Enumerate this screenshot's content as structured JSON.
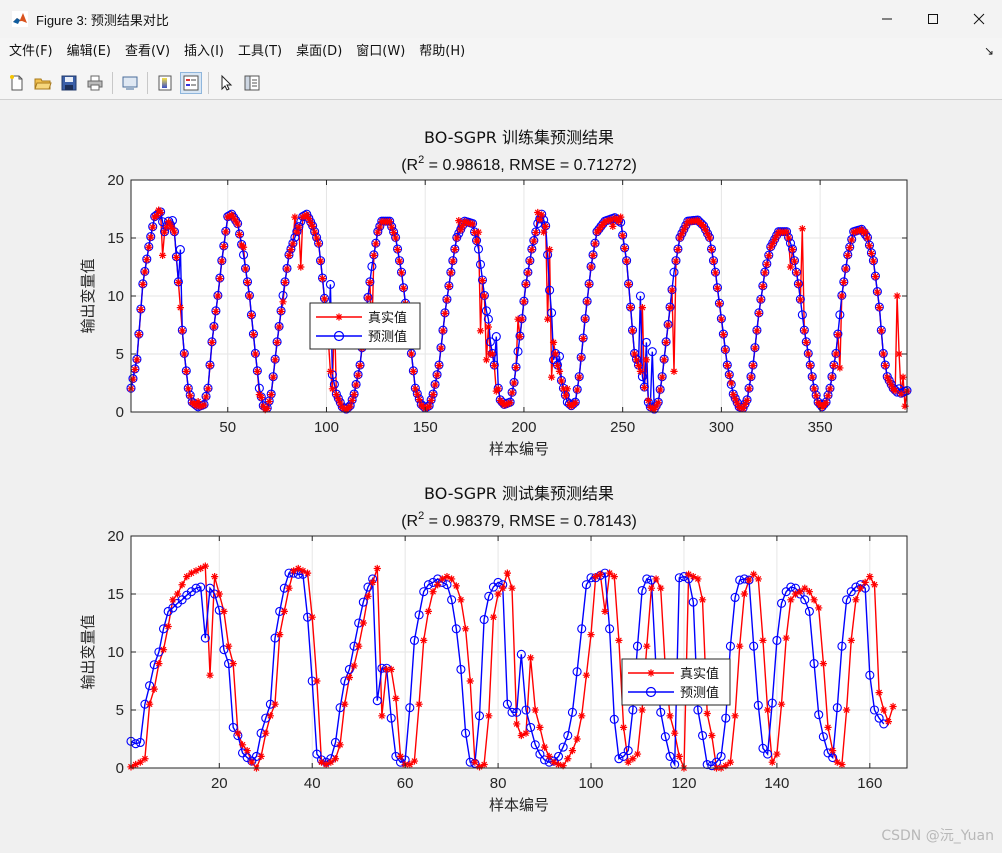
{
  "window": {
    "title": "Figure 3: 预测结果对比",
    "controls": {
      "minimize": "—",
      "maximize": "☐",
      "close": "✕"
    }
  },
  "menu": {
    "items": [
      "文件(F)",
      "编辑(E)",
      "查看(V)",
      "插入(I)",
      "工具(T)",
      "桌面(D)",
      "窗口(W)",
      "帮助(H)"
    ],
    "overflow_arrow": "↘"
  },
  "toolbar": {
    "buttons": [
      "new-file-icon",
      "open-folder-icon",
      "save-icon",
      "print-icon",
      "link-figure-icon",
      "colorbar-icon",
      "legend-icon",
      "pointer-icon",
      "property-inspector-icon"
    ]
  },
  "colors": {
    "true": "#ff0000",
    "pred": "#0000ff",
    "axes_bg": "#ffffff",
    "grid": "#e6e6e6"
  },
  "watermark": "CSDN @沅_Yuan",
  "chart_data": [
    {
      "type": "line",
      "title": "BO-SGPR 训练集预测结果",
      "subtitle_prefix": "(R",
      "subtitle_sup": "2",
      "subtitle_suffix": " = 0.98618, RMSE = 0.71272)",
      "xlabel": "样本编号",
      "ylabel": "输出变量值",
      "xlim": [
        1,
        394
      ],
      "ylim": [
        0,
        20
      ],
      "xticks": [
        50,
        100,
        150,
        200,
        250,
        300,
        350
      ],
      "yticks": [
        0,
        5,
        10,
        15,
        20
      ],
      "grid": true,
      "legend": {
        "position": "center",
        "entries": [
          "真实值",
          "预测值"
        ]
      },
      "n": 394,
      "anchors": [
        [
          1,
          2
        ],
        [
          4,
          4.5
        ],
        [
          7,
          11
        ],
        [
          10,
          14.2
        ],
        [
          13,
          16.8
        ],
        [
          16,
          17.2
        ],
        [
          18,
          15.5
        ],
        [
          20,
          16.4
        ],
        [
          23,
          15.5
        ],
        [
          26,
          9
        ],
        [
          28,
          5
        ],
        [
          30,
          2
        ],
        [
          32,
          0.8
        ],
        [
          35,
          0.4
        ],
        [
          38,
          0.6
        ],
        [
          40,
          2
        ],
        [
          42,
          6
        ],
        [
          45,
          10
        ],
        [
          47,
          13
        ],
        [
          50,
          16.8
        ],
        [
          52,
          17
        ],
        [
          55,
          16.2
        ],
        [
          58,
          13.5
        ],
        [
          61,
          10
        ],
        [
          64,
          5
        ],
        [
          66,
          2
        ],
        [
          68,
          0.5
        ],
        [
          70,
          0.3
        ],
        [
          72,
          1.5
        ],
        [
          75,
          6
        ],
        [
          78,
          10
        ],
        [
          81,
          13.5
        ],
        [
          85,
          15.5
        ],
        [
          88,
          16.8
        ],
        [
          90,
          17
        ],
        [
          93,
          16
        ],
        [
          96,
          14.5
        ],
        [
          98,
          11.5
        ],
        [
          100,
          8
        ],
        [
          102,
          4
        ],
        [
          105,
          1.5
        ],
        [
          108,
          0.4
        ],
        [
          110,
          0.2
        ],
        [
          112,
          0.5
        ],
        [
          114,
          1.5
        ],
        [
          117,
          4
        ],
        [
          120,
          8.5
        ],
        [
          123,
          12.5
        ],
        [
          126,
          15.5
        ],
        [
          128,
          16.4
        ],
        [
          132,
          16.4
        ],
        [
          135,
          15
        ],
        [
          138,
          12
        ],
        [
          141,
          8
        ],
        [
          143,
          5
        ],
        [
          145,
          2
        ],
        [
          148,
          0.6
        ],
        [
          150,
          0.3
        ],
        [
          152,
          0.5
        ],
        [
          154,
          1.5
        ],
        [
          157,
          4
        ],
        [
          160,
          8.5
        ],
        [
          163,
          12
        ],
        [
          166,
          15
        ],
        [
          170,
          16.4
        ],
        [
          174,
          16.2
        ],
        [
          177,
          14
        ],
        [
          180,
          10
        ],
        [
          183,
          6
        ],
        [
          186,
          3
        ],
        [
          188,
          1
        ],
        [
          190,
          0.6
        ],
        [
          193,
          0.8
        ],
        [
          195,
          2.5
        ],
        [
          198,
          6.5
        ],
        [
          201,
          11
        ],
        [
          204,
          14
        ],
        [
          207,
          16.2
        ],
        [
          209,
          17
        ],
        [
          211,
          16
        ],
        [
          213,
          11
        ],
        [
          215,
          6
        ],
        [
          217,
          4
        ],
        [
          220,
          2
        ],
        [
          222,
          0.8
        ],
        [
          224,
          0.5
        ],
        [
          226,
          0.8
        ],
        [
          228,
          3
        ],
        [
          231,
          8
        ],
        [
          234,
          12.5
        ],
        [
          237,
          15.5
        ],
        [
          241,
          16.4
        ],
        [
          246,
          16.7
        ],
        [
          249,
          16.3
        ],
        [
          252,
          13
        ],
        [
          254,
          9
        ],
        [
          256,
          5
        ],
        [
          258,
          4
        ],
        [
          260,
          3
        ],
        [
          262,
          1.2
        ],
        [
          264,
          0.4
        ],
        [
          266,
          0.2
        ],
        [
          268,
          0.8
        ],
        [
          270,
          3
        ],
        [
          273,
          7.5
        ],
        [
          276,
          12
        ],
        [
          279,
          15
        ],
        [
          283,
          16.4
        ],
        [
          288,
          16.5
        ],
        [
          291,
          16
        ],
        [
          294,
          15
        ],
        [
          297,
          12
        ],
        [
          300,
          8
        ],
        [
          303,
          4
        ],
        [
          306,
          1.5
        ],
        [
          309,
          0.4
        ],
        [
          311,
          0.3
        ],
        [
          313,
          1
        ],
        [
          316,
          4
        ],
        [
          319,
          8.5
        ],
        [
          322,
          12
        ],
        [
          325,
          14.2
        ],
        [
          329,
          15.5
        ],
        [
          333,
          15.5
        ],
        [
          336,
          14
        ],
        [
          339,
          11
        ],
        [
          342,
          7
        ],
        [
          345,
          4
        ],
        [
          347,
          2
        ],
        [
          349,
          0.8
        ],
        [
          351,
          0.4
        ],
        [
          353,
          0.8
        ],
        [
          355,
          2
        ],
        [
          358,
          5
        ],
        [
          361,
          10
        ],
        [
          364,
          13.5
        ],
        [
          367,
          15.5
        ],
        [
          371,
          15.7
        ],
        [
          374,
          15
        ],
        [
          377,
          13
        ],
        [
          380,
          9
        ],
        [
          382,
          5
        ],
        [
          384,
          3
        ],
        [
          387,
          2
        ],
        [
          390,
          1.5
        ],
        [
          394,
          1.8
        ]
      ],
      "true_spikes": [
        [
          15,
          17.4
        ],
        [
          17,
          13.5
        ],
        [
          35,
          0.9
        ],
        [
          58,
          14.2
        ],
        [
          66,
          1.5
        ],
        [
          69,
          0.2
        ],
        [
          78,
          9.5
        ],
        [
          84,
          16.8
        ],
        [
          87,
          12.5
        ],
        [
          102,
          3.5
        ],
        [
          103,
          2
        ],
        [
          104,
          8.5
        ],
        [
          123,
          7
        ],
        [
          167,
          16.5
        ],
        [
          177,
          15.5
        ],
        [
          178,
          7
        ],
        [
          181,
          4.5
        ],
        [
          183,
          5
        ],
        [
          186,
          1.8
        ],
        [
          197,
          8
        ],
        [
          203,
          13
        ],
        [
          207,
          17.2
        ],
        [
          210,
          15.5
        ],
        [
          212,
          8
        ],
        [
          213,
          14
        ],
        [
          214,
          3
        ],
        [
          218,
          3.5
        ],
        [
          222,
          2
        ],
        [
          245,
          16
        ],
        [
          249,
          16.8
        ],
        [
          260,
          9
        ],
        [
          262,
          4.5
        ],
        [
          263,
          1
        ],
        [
          276,
          3.5
        ],
        [
          305,
          2.5
        ],
        [
          335,
          12.5
        ],
        [
          341,
          15.8
        ],
        [
          360,
          3.8
        ],
        [
          373,
          15.5
        ],
        [
          389,
          10
        ],
        [
          390,
          5
        ],
        [
          392,
          3
        ],
        [
          393,
          0.5
        ]
      ],
      "pred_spikes": [
        [
          22,
          16.5
        ],
        [
          26,
          14
        ],
        [
          102,
          11
        ],
        [
          182,
          8
        ],
        [
          186,
          6.5
        ],
        [
          213,
          10.5
        ],
        [
          215,
          4.5
        ],
        [
          218,
          4.8
        ],
        [
          259,
          10
        ],
        [
          262,
          6
        ],
        [
          265,
          5.2
        ],
        [
          390,
          2
        ]
      ]
    },
    {
      "type": "line",
      "title": "BO-SGPR 测试集预测结果",
      "subtitle_prefix": "(R",
      "subtitle_sup": "2",
      "subtitle_suffix": " = 0.98379, RMSE = 0.78143)",
      "xlabel": "样本编号",
      "ylabel": "输出变量值",
      "xlim": [
        1,
        168
      ],
      "ylim": [
        0,
        20
      ],
      "xticks": [
        20,
        40,
        60,
        80,
        100,
        120,
        140,
        160
      ],
      "yticks": [
        0,
        5,
        10,
        15,
        20
      ],
      "grid": true,
      "legend": {
        "position": "right-center",
        "entries": [
          "真实值",
          "预测值"
        ]
      },
      "n": 168,
      "true": [
        0.1,
        0.3,
        0.5,
        0.8,
        5.5,
        6.8,
        9,
        10.2,
        12.2,
        14.5,
        15,
        15.8,
        16.5,
        16.8,
        17,
        17.2,
        17.4,
        8,
        16.5,
        15,
        13.5,
        10.5,
        9,
        3,
        2,
        1.5,
        0.5,
        0,
        1,
        3,
        4.5,
        5.5,
        11.5,
        13.5,
        15.5,
        17,
        17.2,
        17,
        16.8,
        13,
        7.5,
        0.5,
        0.3,
        0.5,
        0.8,
        2,
        5.5,
        7.8,
        8.8,
        10.5,
        12.5,
        14.8,
        16,
        17.2,
        4.5,
        8.5,
        8.5,
        6,
        1,
        0.3,
        0.3,
        0.6,
        5.5,
        11,
        13.5,
        15.2,
        15.8,
        16.3,
        16.5,
        16.3,
        15.7,
        14.5,
        12,
        7.5,
        0.5,
        0.1,
        0.3,
        4.5,
        13,
        15,
        15.5,
        16.8,
        15.5,
        3.8,
        2.8,
        3,
        9.5,
        5,
        3.5,
        1.8,
        1,
        0.5,
        0.3,
        0.2,
        0.8,
        1.5,
        2.5,
        4.5,
        8,
        11.5,
        16.5,
        16.7,
        13.5,
        16.8,
        16.5,
        11,
        3.5,
        0.5,
        0.8,
        1.2,
        5,
        10.5,
        15.5,
        16.3,
        15.5,
        8.5,
        4.5,
        3,
        1,
        0,
        16.7,
        16.5,
        16.3,
        14.5,
        4.7,
        2.8,
        0,
        0,
        0.2,
        0.5,
        4.5,
        10.5,
        15,
        16.2,
        16.7,
        16.3,
        11,
        5,
        0.5,
        1.2,
        5.5,
        11.2,
        14.5,
        15,
        15.2,
        15.5,
        15.2,
        14.5,
        13.8,
        9,
        3.5,
        1.5,
        0.5,
        0.3,
        5,
        11,
        14.5,
        15.5,
        16,
        16.5,
        15.8,
        6.5,
        5,
        4,
        5.3
      ],
      "pred": [
        2.3,
        2.1,
        2.2,
        5.5,
        7.1,
        8.9,
        10,
        12,
        13.5,
        13.8,
        14.2,
        14.5,
        14.9,
        15.2,
        15.5,
        15.6,
        11.2,
        15.5,
        15,
        13.6,
        10.2,
        9,
        3.5,
        2.8,
        1.3,
        0.9,
        0.6,
        1,
        3,
        4.3,
        5.5,
        11.2,
        13.5,
        15.5,
        16.8,
        16.8,
        16.7,
        16.7,
        13,
        7.5,
        1.2,
        0.7,
        0.5,
        0.8,
        2.2,
        5.2,
        7.5,
        8.5,
        10.5,
        12.5,
        14.3,
        15.6,
        16.3,
        5.8,
        8.6,
        8.6,
        4.3,
        1,
        0.5,
        0.7,
        5.2,
        11,
        13.2,
        15.2,
        15.8,
        16,
        16.3,
        16,
        15.8,
        14.5,
        12,
        8.5,
        3,
        0.5,
        0.4,
        4.5,
        12.8,
        14.8,
        15.6,
        16,
        15.8,
        5.5,
        4.8,
        4.8,
        9.8,
        5,
        3.5,
        2,
        1.2,
        0.7,
        0.5,
        0.6,
        1,
        1.8,
        2.8,
        4.8,
        8.3,
        12,
        15.8,
        16.4,
        16.4,
        16.6,
        16.8,
        12,
        4.2,
        0.8,
        1,
        1.5,
        5,
        10.5,
        15.3,
        16.3,
        16.2,
        8.5,
        4.8,
        2.7,
        1,
        0.3,
        16.4,
        16.5,
        16.3,
        14.3,
        5,
        2.8,
        0.3,
        0.2,
        0.5,
        1,
        4.3,
        10.5,
        14.7,
        16.2,
        16.3,
        16.2,
        10.5,
        5.4,
        1.7,
        1.2,
        5.6,
        11,
        14.2,
        15.2,
        15.6,
        15.5,
        15,
        14.5,
        13.5,
        9,
        4.6,
        2.7,
        1.3,
        0.9,
        5.2,
        10.5,
        14.5,
        15.2,
        15.6,
        15.8,
        15.5,
        8,
        5,
        4.3,
        3.8
      ]
    }
  ]
}
